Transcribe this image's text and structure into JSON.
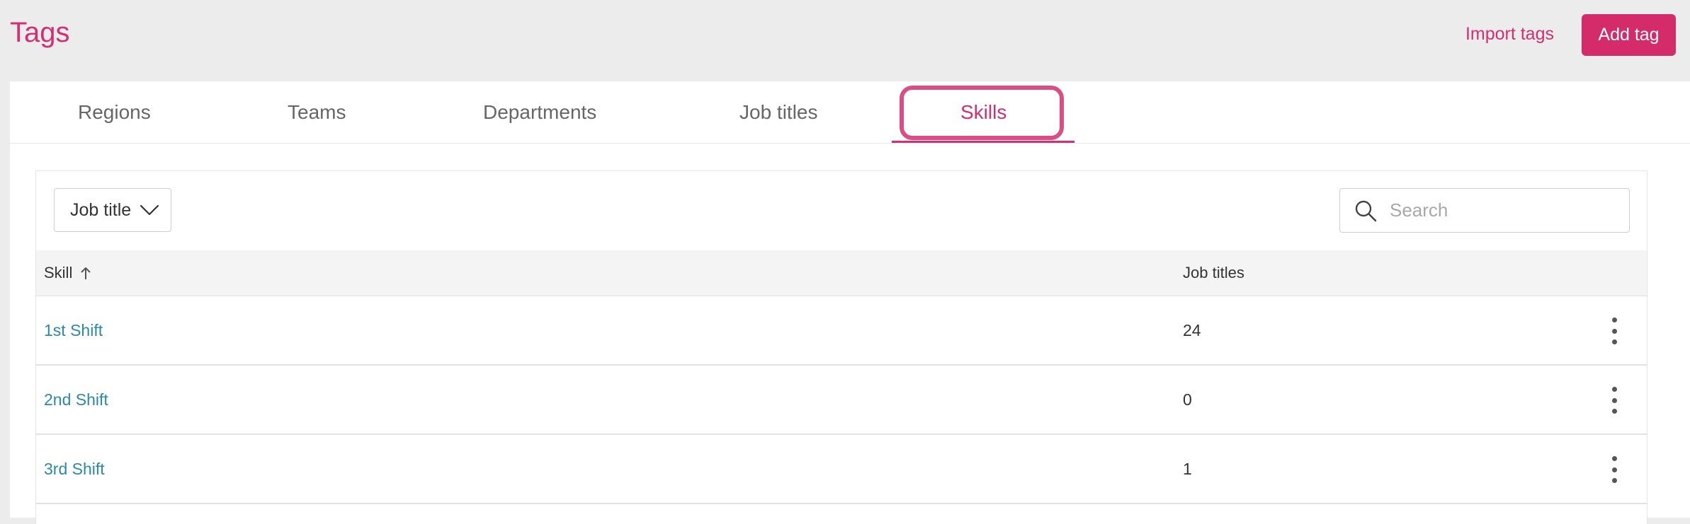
{
  "header": {
    "title": "Tags",
    "import_label": "Import tags",
    "add_label": "Add tag"
  },
  "tabs": [
    {
      "label": "Regions"
    },
    {
      "label": "Teams"
    },
    {
      "label": "Departments"
    },
    {
      "label": "Job titles"
    },
    {
      "label": "Skills",
      "active": true
    }
  ],
  "filter": {
    "label": "Job title",
    "icon": "chevron-down-icon"
  },
  "search": {
    "placeholder": "Search",
    "value": "",
    "icon": "search-icon"
  },
  "table": {
    "columns": [
      "Skill",
      "Job titles"
    ],
    "sort_icon": "arrow-up-icon",
    "rows": [
      {
        "skill": "1st Shift",
        "job_titles": "24"
      },
      {
        "skill": "2nd Shift",
        "job_titles": "0"
      },
      {
        "skill": "3rd Shift",
        "job_titles": "1"
      }
    ],
    "row_menu_icon": "more-vertical-icon"
  },
  "colors": {
    "accent": "#d32f72",
    "link": "#2a8aa8",
    "background": "#ececec"
  }
}
